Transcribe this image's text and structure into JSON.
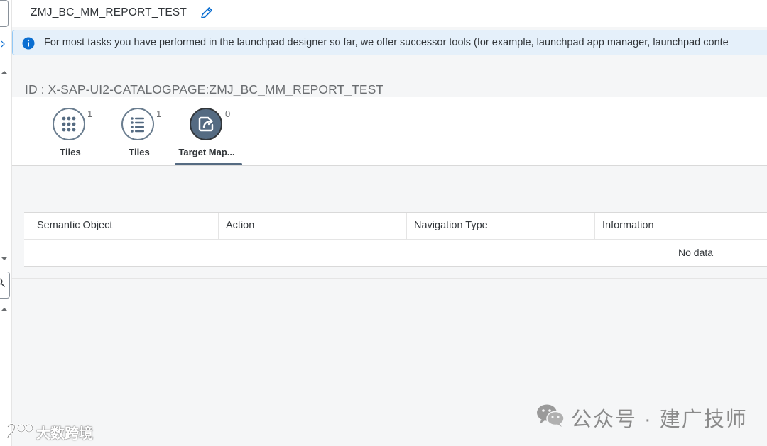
{
  "header": {
    "title": "ZMJ_BC_MM_REPORT_TEST"
  },
  "info": {
    "message": "For most tasks you have performed in the launchpad designer so far, we offer successor tools (for example, launchpad app manager, launchpad conte"
  },
  "page": {
    "id_label": "ID : X-SAP-UI2-CATALOGPAGE:ZMJ_BC_MM_REPORT_TEST"
  },
  "tabs": [
    {
      "label": "Tiles",
      "count": "1",
      "icon": "grid-icon",
      "selected": false
    },
    {
      "label": "Tiles",
      "count": "1",
      "icon": "list-icon",
      "selected": false
    },
    {
      "label": "Target Map...",
      "count": "0",
      "icon": "share-icon",
      "selected": true
    }
  ],
  "table": {
    "columns": [
      "Semantic Object",
      "Action",
      "Navigation Type",
      "Information"
    ],
    "empty_text": "No data"
  },
  "watermarks": {
    "right": "公众号 · 建广技师",
    "left": "大数跨境"
  },
  "colors": {
    "info_bg": "#e5f0fa",
    "info_border": "#91c8f6",
    "info_icon": "#0a6ed1",
    "tab_selected": "#556b82",
    "edit_icon": "#0a6ed1"
  }
}
